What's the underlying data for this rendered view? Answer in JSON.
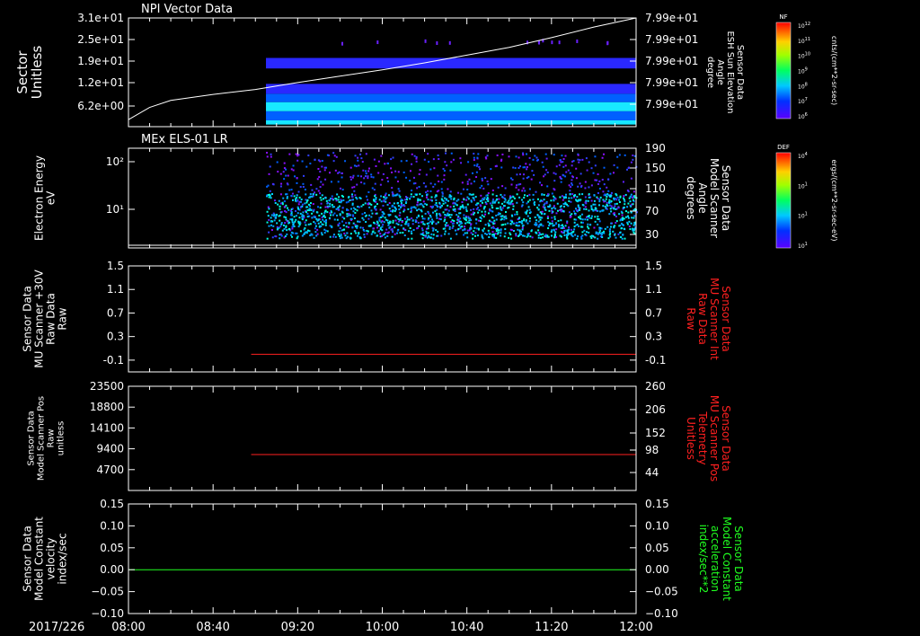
{
  "colors": {
    "background": "#000000",
    "axis": "#ffffff",
    "ref_red": "#ff2020",
    "ref_green": "#20ff20",
    "trace_white": "#ffffff"
  },
  "time_axis": {
    "date_label": "2017/226",
    "ticks": [
      "08:00",
      "08:40",
      "09:20",
      "10:00",
      "10:40",
      "11:20",
      "12:00"
    ],
    "range": [
      "08:00",
      "12:00"
    ]
  },
  "colorbars": [
    {
      "key": "NF",
      "label": "NF",
      "units": "cnts/(cm**2-sr-sec)",
      "scale": "log",
      "tick_exponents": [
        12,
        11,
        10,
        9,
        8,
        7,
        6
      ],
      "tick_mantissa": "10"
    },
    {
      "key": "DEF",
      "label": "DEF",
      "units": "ergs/(cm**2-sr-sec-eV)",
      "scale": "log",
      "tick_exponents": [
        4,
        1,
        1,
        1
      ],
      "tick_mantissa": "10"
    }
  ],
  "chart_data": [
    {
      "type": "heatmap",
      "title": "NPI Vector Data",
      "ylabel": [
        "Sector",
        "Unitless"
      ],
      "ytick_labels": [
        "3.1e+01",
        "2.5e+01",
        "1.9e+01",
        "1.2e+01",
        "6.2e+00"
      ],
      "y_right_label": [
        "Sensor Data",
        "ESH Sun Elevation",
        "Angle",
        "degree"
      ],
      "y_right_tick_labels": [
        "7.99e+01",
        "7.99e+01",
        "7.99e+01",
        "7.99e+01",
        "7.99e+01"
      ],
      "data_start": "09:05",
      "data_end": "12:00",
      "bands": [
        {
          "sector_from": 0.6,
          "sector_to": 1.8,
          "level": "high"
        },
        {
          "sector_from": 1.8,
          "sector_to": 4.4,
          "level": "mid"
        },
        {
          "sector_from": 4.4,
          "sector_to": 7.0,
          "level": "high"
        },
        {
          "sector_from": 7.0,
          "sector_to": 9.4,
          "level": "mid"
        },
        {
          "sector_from": 9.4,
          "sector_to": 12.2,
          "level": "low"
        },
        {
          "sector_from": 16.6,
          "sector_to": 19.6,
          "level": "low"
        }
      ],
      "overlay_line": {
        "color": "#ffffff",
        "points": [
          [
            "08:00",
            2.0
          ],
          [
            "08:10",
            5.5
          ],
          [
            "08:20",
            7.5
          ],
          [
            "08:40",
            9.2
          ],
          [
            "09:00",
            10.6
          ],
          [
            "09:20",
            12.6
          ],
          [
            "09:40",
            14.4
          ],
          [
            "10:00",
            16.2
          ],
          [
            "10:20",
            18.2
          ],
          [
            "10:40",
            20.4
          ],
          [
            "11:00",
            22.6
          ],
          [
            "11:20",
            25.4
          ],
          [
            "11:40",
            28.4
          ],
          [
            "12:00",
            31.0
          ]
        ]
      }
    },
    {
      "type": "heatmap",
      "title": "MEx ELS-01 LR",
      "ylabel": [
        "Electron Energy",
        "eV"
      ],
      "yscale": "log",
      "ytick_labels": [
        "10²",
        "10¹"
      ],
      "y_right_label": [
        "Sensor Data",
        "Model Scanner",
        "Angle",
        "degrees"
      ],
      "y_right_tick_labels": [
        "190",
        "150",
        "110",
        "70",
        "30"
      ],
      "data_start": "09:05",
      "data_end": "12:00",
      "overlay_line": {
        "color": "#ffffff",
        "level": "floor"
      }
    },
    {
      "type": "line",
      "ylabel": [
        "Sensor Data",
        "MU Scanner +30V",
        "Raw Data",
        "Raw"
      ],
      "ytick_labels": [
        "1.5",
        "1.1",
        "0.7",
        "0.3",
        "-0.1"
      ],
      "ylim": [
        -0.3,
        1.5
      ],
      "y_right_label": [
        "Sensor Data",
        "MU Scanner Int",
        "Raw Data",
        "Raw"
      ],
      "y_right_tick_labels": [
        "1.5",
        "1.1",
        "0.7",
        "0.3",
        "-0.1"
      ],
      "series": [
        {
          "color": "#ff2020",
          "x": [
            "08:58",
            "12:00"
          ],
          "y": [
            0.0,
            0.0
          ]
        }
      ]
    },
    {
      "type": "line",
      "ylabel": [
        "Sensor Data",
        "Model Scanner Pos",
        "Raw",
        "unitless"
      ],
      "ytick_labels": [
        "23500",
        "18800",
        "14100",
        "9400",
        "4700"
      ],
      "ylim": [
        0,
        23500
      ],
      "y_right_label": [
        "Sensor Data",
        "MU Scanner Pos",
        "Telemetry",
        "Unitless"
      ],
      "y_right_tick_labels": [
        "260",
        "206",
        "152",
        "98",
        "44"
      ],
      "series": [
        {
          "color": "#ff2020",
          "x": [
            "08:58",
            "12:00"
          ],
          "y": [
            8100,
            8100
          ]
        }
      ]
    },
    {
      "type": "line",
      "ylabel": [
        "Sensor Data",
        "Model Constant",
        "velocity",
        "index/sec"
      ],
      "ytick_labels": [
        "0.15",
        "0.10",
        "0.05",
        "0.00",
        "−0.05",
        "−0.10"
      ],
      "ylim": [
        -0.1,
        0.15
      ],
      "y_right_label": [
        "Sensor Data",
        "Model Constant",
        "acceleration",
        "index/sec**2"
      ],
      "y_right_tick_labels": [
        "0.15",
        "0.10",
        "0.05",
        "0.00",
        "−0.05",
        "−0.10"
      ],
      "series": [
        {
          "color": "#20ff20",
          "x": [
            "08:00",
            "12:00"
          ],
          "y": [
            0.0,
            0.0
          ]
        }
      ]
    }
  ]
}
